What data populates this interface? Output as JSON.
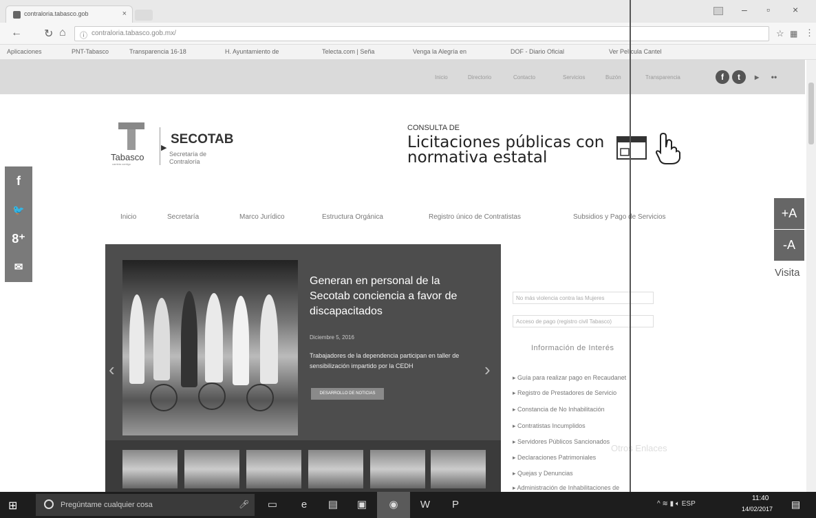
{
  "browser": {
    "tab_title": "contraloria.tabasco.gob",
    "url": "contraloria.tabasco.gob.mx/",
    "bookmarks": [
      "Aplicaciones",
      "PNT-Tabasco",
      "Transparencia 16-18",
      "H. Ayuntamiento de",
      "Telecta.com | Seña",
      "Venga la Alegría en",
      "DOF - Diario Oficial",
      "Ver Película Cantel"
    ]
  },
  "site": {
    "top_nav": [
      "Inicio",
      "Directorio",
      "Contacto",
      "Servicios",
      "Buzón",
      "Transparencia"
    ],
    "logo": {
      "name": "Tabasco",
      "tagline": "cambia contigo"
    },
    "brand": {
      "name": "SECOTAB",
      "line1": "Secretaría de",
      "line2": "Contraloría"
    },
    "banner": {
      "kicker": "CONSULTA DE",
      "line1": "Licitaciones públicas con",
      "line2": "normativa estatal"
    },
    "main_nav": [
      "Inicio",
      "Secretaría",
      "Marco Jurídico",
      "Estructura Orgánica",
      "Registro único de Contratistas",
      "Subsidios y Pago de Servicios"
    ],
    "font_controls": [
      "+A",
      "-A"
    ],
    "visita_label": "Visita",
    "slide": {
      "title": "Generan en personal de la Secotab conciencia a favor de discapacitados",
      "date": "Diciembre 5, 2016",
      "desc": "Trabajadores de la dependencia participan en taller de sensibilización impartido por la CEDH",
      "button": "DESARROLLO DE NOTICIAS"
    },
    "image_links": [
      "No más violencia contra las Mujeres",
      "Acceso de pago (registro civil Tabasco)"
    ],
    "info_title": "Información de Interés",
    "info_links": [
      "Guía para realizar pago en Recaudanet",
      "Registro de Prestadores de Servicio",
      "Constancia de No Inhabilitación",
      "Contratistas Incumplidos",
      "Servidores Públicos Sancionados",
      "Declaraciones Patrimoniales",
      "Quejas y Denuncias",
      "Administración de Inhabilitaciones de"
    ],
    "ghost_text": "Otros Enlaces"
  },
  "taskbar": {
    "search_placeholder": "Pregúntame cualquier cosa",
    "tray_lang": "ESP",
    "time": "11:40",
    "date": "14/02/2017"
  }
}
